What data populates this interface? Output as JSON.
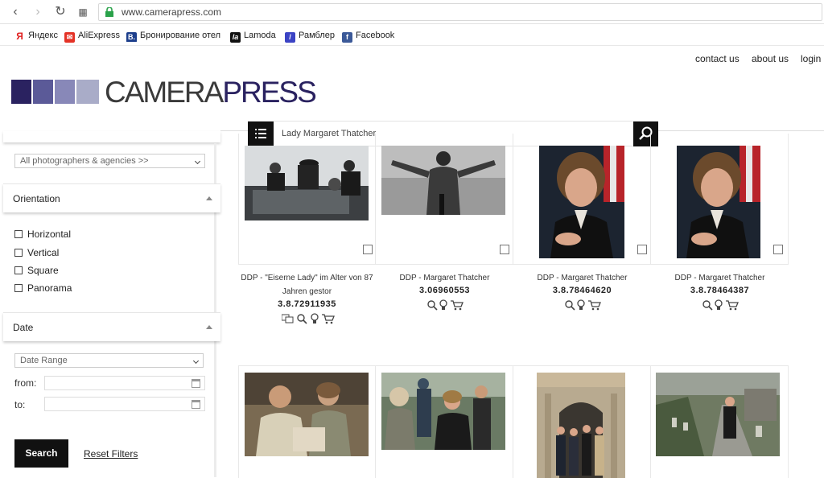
{
  "browser": {
    "url": "www.camerapress.com",
    "bookmarks": [
      {
        "label": "Яндекс",
        "icon": "yandex-icon",
        "color": "#e02020"
      },
      {
        "label": "AliExpress",
        "icon": "aliexpress-icon",
        "color": "#e43226"
      },
      {
        "label": "Бронирование отел",
        "icon": "booking-icon",
        "color": "#1d3f8c"
      },
      {
        "label": "Lamoda",
        "icon": "lamoda-icon",
        "color": "#111111"
      },
      {
        "label": "Рамблер",
        "icon": "rambler-icon",
        "color": "#3b43c4"
      },
      {
        "label": "Facebook",
        "icon": "facebook-icon",
        "color": "#3b5998"
      }
    ]
  },
  "header": {
    "links": [
      "contact us",
      "about us",
      "login"
    ],
    "logo_camera": "CAMERA",
    "logo_press": "PRESS",
    "logo_colors": [
      "#2a2260",
      "#5b5a98",
      "#8888b8",
      "#a9acc8"
    ]
  },
  "search": {
    "query": "Lady Margaret Thatcher"
  },
  "sidebar": {
    "photographers_select": "All photographers & agencies >>",
    "orientation_title": "Orientation",
    "orientation_options": [
      "Horizontal",
      "Vertical",
      "Square",
      "Panorama"
    ],
    "date_title": "Date",
    "date_range_select": "Date Range",
    "from_label": "from:",
    "to_label": "to:",
    "search_button": "Search",
    "reset_link": "Reset Filters"
  },
  "results": [
    {
      "caption": "DDP - \"Eiserne Lady\" im Alter von 87 Jahren gestor",
      "code": "3.8.72911935",
      "tools": [
        "compare-icon",
        "zoom-icon",
        "lightbulb-icon",
        "cart-icon"
      ]
    },
    {
      "caption": "DDP - Margaret Thatcher",
      "code": "3.06960553",
      "tools": [
        "zoom-icon",
        "lightbulb-icon",
        "cart-icon"
      ]
    },
    {
      "caption": "DDP - Margaret Thatcher",
      "code": "3.8.78464620",
      "tools": [
        "zoom-icon",
        "lightbulb-icon",
        "cart-icon"
      ]
    },
    {
      "caption": "DDP - Margaret Thatcher",
      "code": "3.8.78464387",
      "tools": [
        "zoom-icon",
        "lightbulb-icon",
        "cart-icon"
      ]
    }
  ]
}
